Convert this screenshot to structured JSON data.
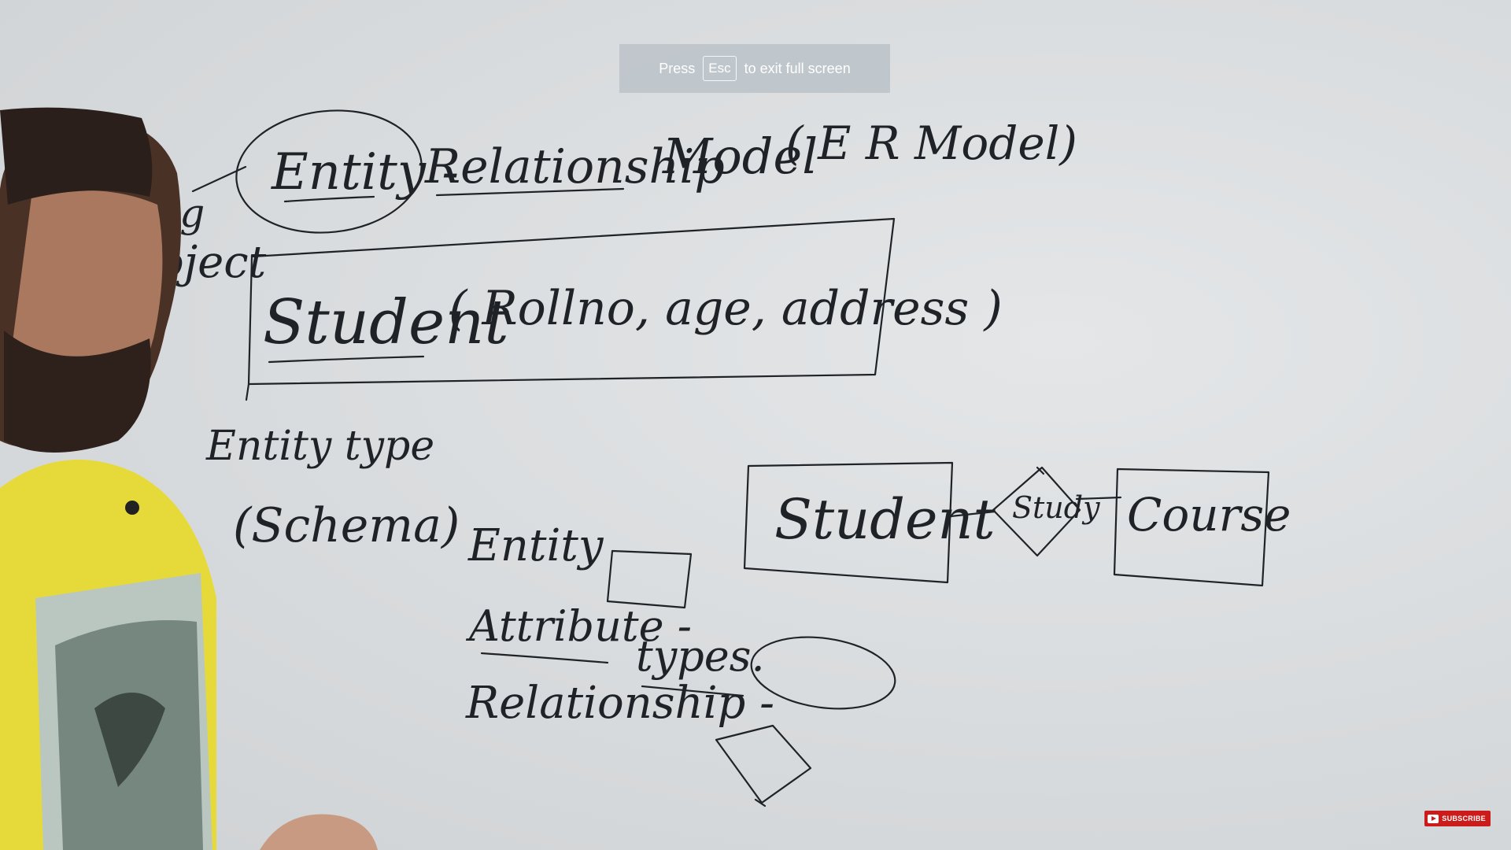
{
  "fullscreen_hint": {
    "press": "Press",
    "key": "Esc",
    "rest": "to exit full screen"
  },
  "board": {
    "title": {
      "entity": "Entity -",
      "relationship": "Relationship",
      "model": "Model",
      "er_model": "( E R Model)"
    },
    "margin_words": {
      "top": "ng",
      "bottom": "oject"
    },
    "schema": {
      "name": "Student",
      "attributes": "( Rollno, age, address )"
    },
    "entity_type": {
      "label": "Entity type",
      "schema": "(Schema)"
    },
    "legend": {
      "entity": "Entity",
      "attribute": "Attribute -",
      "types": "types.",
      "relationship": "Relationship -"
    },
    "er_diagram": {
      "entity_1": "Student",
      "relationship": "Study",
      "entity_2": "Course"
    }
  },
  "subscribe_badge": {
    "label": "SUBSCRIBE"
  },
  "colors": {
    "ink": "#1f2328",
    "board": "#dcdfe1",
    "shirt": "#e7dc3a",
    "badge": "#cc1b1b"
  }
}
